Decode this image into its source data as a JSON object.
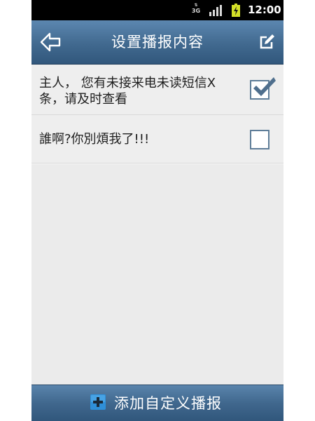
{
  "status_bar": {
    "network_label": "3G",
    "time": "12:00",
    "battery_color": "#d3e028",
    "icons": [
      "data-arrows-icon",
      "signal-icon",
      "battery-charging-icon"
    ]
  },
  "header": {
    "title": "设置播报内容",
    "back_icon": "back-arrow-icon",
    "edit_icon": "edit-icon"
  },
  "items": [
    {
      "label": "主人， 您有未接来电未读短信X条，请及时查看",
      "checked": true
    },
    {
      "label": "誰啊?你別煩我了!!!",
      "checked": false
    }
  ],
  "footer": {
    "add_label": "添加自定义播报",
    "add_icon": "plus-icon"
  },
  "colors": {
    "accent": "#41698f",
    "checkbox_border": "#5e7d98",
    "background": "#ebebeb"
  }
}
